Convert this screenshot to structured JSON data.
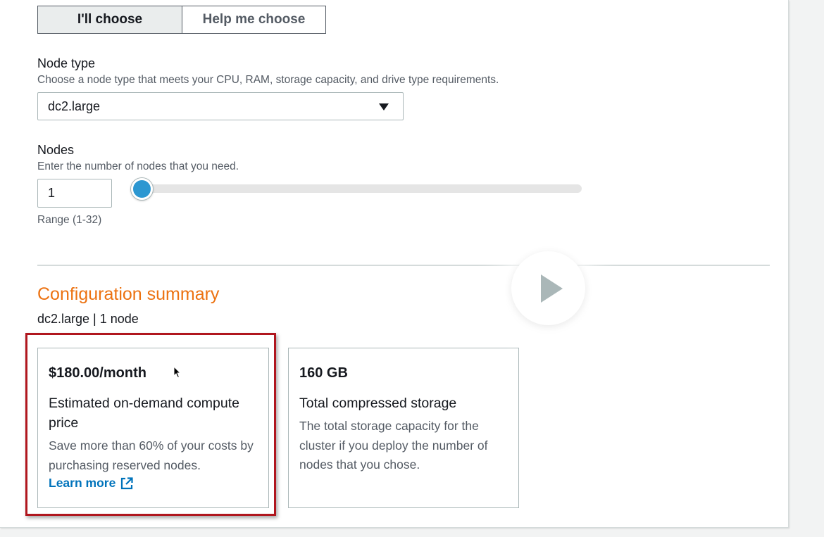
{
  "mode_toggle": {
    "selected_label": "I'll choose",
    "other_label": "Help me choose"
  },
  "node_type": {
    "label": "Node type",
    "description": "Choose a node type that meets your CPU, RAM, storage capacity, and drive type requirements.",
    "selected_value": "dc2.large"
  },
  "nodes": {
    "label": "Nodes",
    "description": "Enter the number of nodes that you need.",
    "value": "1",
    "range_text": "Range (1-32)",
    "slider_min": 1,
    "slider_max": 32,
    "slider_value": 1
  },
  "summary": {
    "title": "Configuration summary",
    "subtitle": "dc2.large | 1 node",
    "price_card": {
      "value": "$180.00/month",
      "heading": "Estimated on-demand compute price",
      "body": "Save more than 60% of your costs by purchasing reserved nodes.",
      "link": "Learn more"
    },
    "storage_card": {
      "value": "160 GB",
      "heading": "Total compressed storage",
      "body": "The total storage capacity for the cluster if you deploy the number of nodes that you chose."
    }
  },
  "colors": {
    "accent_orange": "#ec7211",
    "link_blue": "#0073bb",
    "slider_blue": "#2c97d1",
    "highlight_red": "#b0161e"
  },
  "icons": {
    "dropdown": "caret-down-icon",
    "external_link": "external-link-icon",
    "play": "play-icon",
    "cursor": "mouse-pointer-icon"
  }
}
